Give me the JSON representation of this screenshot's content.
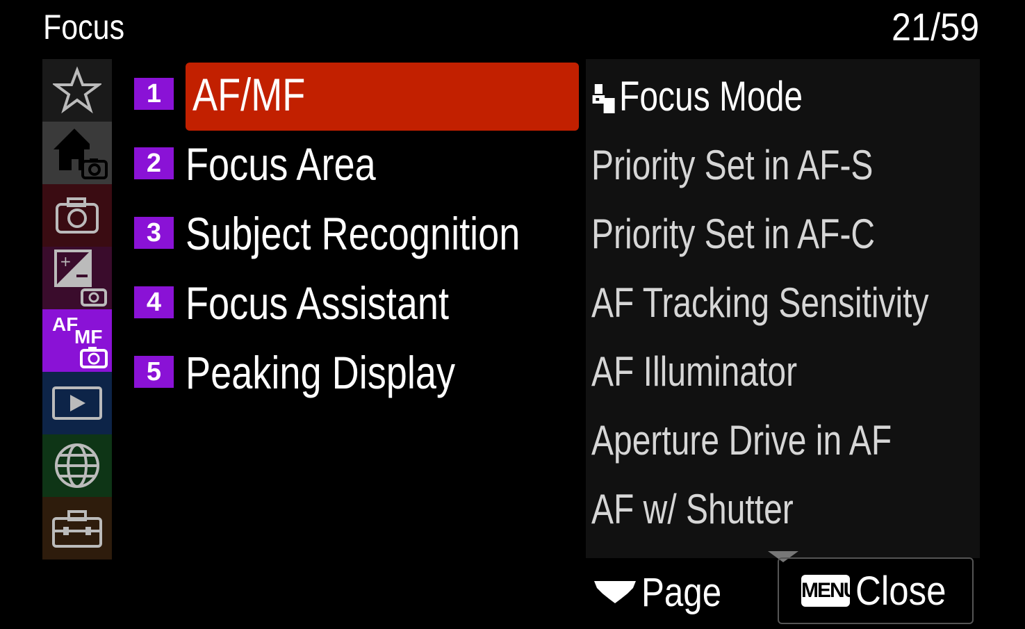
{
  "header": {
    "title": "Focus",
    "page_counter": "21/59"
  },
  "tabs": [
    {
      "icon": "star-icon",
      "bg": "#1a1a1a",
      "active": false
    },
    {
      "icon": "home-camera-icon",
      "bg": "#3a3a3a",
      "active": false
    },
    {
      "icon": "camera-icon",
      "bg": "#3a0c12",
      "active": false
    },
    {
      "icon": "exposure-camera-icon",
      "bg": "#3a0c2c",
      "active": false
    },
    {
      "icon": "af-mf-camera-icon",
      "bg": "#8a12d6",
      "active": true,
      "text_af": "AF",
      "text_mf": "MF"
    },
    {
      "icon": "playback-icon",
      "bg": "#0d2448",
      "active": false
    },
    {
      "icon": "globe-icon",
      "bg": "#0e3516",
      "active": false
    },
    {
      "icon": "toolbox-icon",
      "bg": "#2e1c0c",
      "active": false
    }
  ],
  "menu": {
    "items": [
      {
        "num": "1",
        "label": "AF/MF",
        "selected": true
      },
      {
        "num": "2",
        "label": "Focus Area",
        "selected": false
      },
      {
        "num": "3",
        "label": "Subject Recognition",
        "selected": false
      },
      {
        "num": "4",
        "label": "Focus Assistant",
        "selected": false
      },
      {
        "num": "5",
        "label": "Peaking Display",
        "selected": false
      }
    ]
  },
  "preview": {
    "items": [
      "Focus Mode",
      "Priority Set in AF-S",
      "Priority Set in AF-C",
      "AF Tracking Sensitivity",
      "AF Illuminator",
      "Aperture Drive in AF",
      "AF w/ Shutter"
    ]
  },
  "footer": {
    "page_label": "Page",
    "menu_badge": "MENU",
    "close_label": "Close"
  },
  "colors": {
    "selection": "#c22000",
    "number_badge": "#8a12d6",
    "panel_bg": "#111111"
  }
}
